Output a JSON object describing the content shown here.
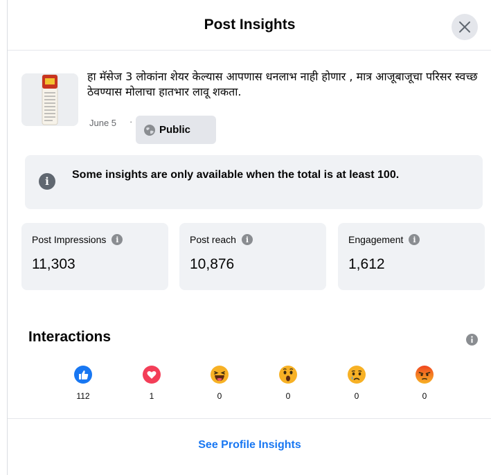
{
  "dialog": {
    "title": "Post Insights",
    "close_icon": "close-icon"
  },
  "post": {
    "text": "हा मॅसेज 3 लोकांना शेयर केल्यास आपणास धनलाभ नाही होणार , मात्र आजूबाजूचा परिसर स्वच्छ ठेवण्यास मोलाचा हातभार लावू शकता.",
    "date": "June 5",
    "separator": "·",
    "audience": "Public",
    "audience_icon": "globe-icon"
  },
  "notice": {
    "icon": "info-icon",
    "text": "Some insights are only available when the total is at least 100."
  },
  "metrics": [
    {
      "label": "Post Impressions",
      "value": "11,303"
    },
    {
      "label": "Post reach",
      "value": "10,876"
    },
    {
      "label": "Engagement",
      "value": "1,612"
    }
  ],
  "interactions": {
    "title": "Interactions",
    "reactions": [
      {
        "name": "like",
        "icon": "like-icon",
        "count": "112",
        "color": "#1877f2"
      },
      {
        "name": "love",
        "icon": "love-icon",
        "count": "1",
        "color": "#f33e58"
      },
      {
        "name": "haha",
        "icon": "haha-icon",
        "count": "0",
        "color": "#f7b125"
      },
      {
        "name": "wow",
        "icon": "wow-icon",
        "count": "0",
        "color": "#f7b125"
      },
      {
        "name": "sad",
        "icon": "sad-icon",
        "count": "0",
        "color": "#f7b125"
      },
      {
        "name": "angry",
        "icon": "angry-icon",
        "count": "0",
        "color": "#e9710f"
      }
    ]
  },
  "footer": {
    "link": "See Profile Insights"
  },
  "colors": {
    "accent": "#1877f2",
    "card_bg": "#f0f2f5",
    "badge_bg": "#e4e6eb",
    "secondary_text": "#65676b"
  }
}
